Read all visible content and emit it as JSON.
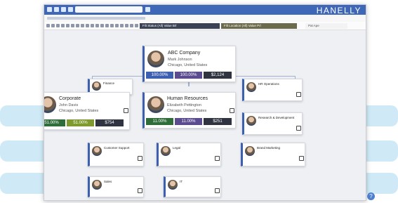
{
  "app": {
    "brand": "HANELLY",
    "help_label": "?"
  },
  "toolbar": {
    "search_value": ""
  },
  "filters": {
    "chip1": "Filt Status (All) Value Brl",
    "chip2": "Filt Location (All) Value Prl",
    "extra": "Pat Ape"
  },
  "cards": {
    "abc": {
      "name": "ABC Company",
      "person": "Mark Johnson",
      "location": "Chicago, United States",
      "b1": "100.00%",
      "b2": "100.00%",
      "b3": "$2,124"
    },
    "corporate": {
      "name": "Corporate",
      "person": "John Davis",
      "location": "Chicago, United States",
      "b1": "51.00%",
      "b2": "51.00%",
      "b3": "$754"
    },
    "hr": {
      "name": "Human Resources",
      "person": "Elizabeth Pettington",
      "location": "Chicago, United States",
      "b1": "11.00%",
      "b2": "11.00%",
      "b3": "$251"
    },
    "finance": {
      "name": "Finance",
      "person": "",
      "location": "",
      "b1": "",
      "b2": "",
      "b3": ""
    },
    "customer": {
      "name": "Customer Support",
      "person": "",
      "location": "",
      "b1": "",
      "b2": "",
      "b3": ""
    },
    "legal": {
      "name": "Legal",
      "person": "",
      "location": "",
      "b1": "",
      "b2": "",
      "b3": ""
    },
    "sales": {
      "name": "Sales",
      "person": "",
      "location": "",
      "b1": "",
      "b2": "",
      "b3": ""
    },
    "it": {
      "name": "IT",
      "person": "",
      "location": "",
      "b1": "",
      "b2": "",
      "b3": ""
    },
    "research": {
      "name": "Research & Development",
      "person": "",
      "location": "",
      "b1": "",
      "b2": "",
      "b3": ""
    },
    "brand": {
      "name": "Brand Marketing",
      "person": "",
      "location": "",
      "b1": "",
      "b2": "",
      "b3": ""
    },
    "hrops": {
      "name": "HR Operations",
      "person": "",
      "location": "",
      "b1": "",
      "b2": "",
      "b3": ""
    }
  },
  "colors": {
    "accent": "#3d5fb0",
    "green": "#2f6d3b",
    "olive": "#7f9a2e",
    "purple": "#5b4b8f",
    "dark": "#2f3440",
    "chip1": "#3a4254",
    "chip2": "#6b6a4a"
  }
}
